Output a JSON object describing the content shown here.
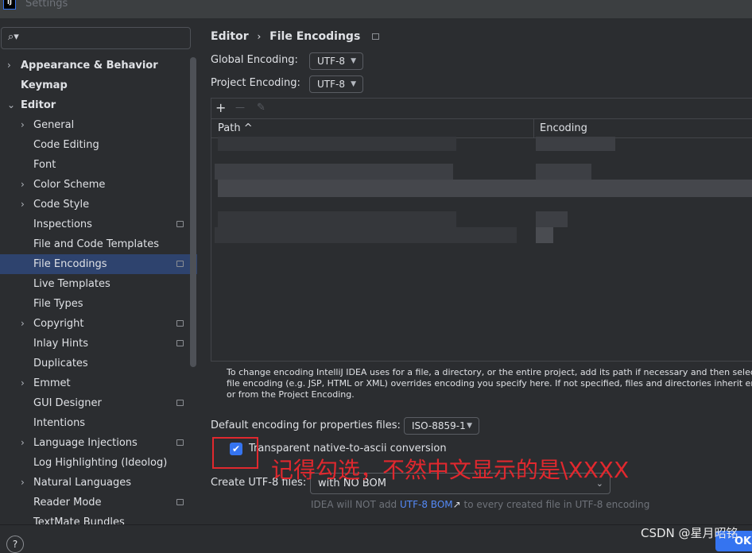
{
  "window": {
    "title": "Settings",
    "logo": "IJ"
  },
  "search": {
    "icon": "search-icon",
    "placeholder": ""
  },
  "sidebar": {
    "items": [
      {
        "label": "Appearance & Behavior",
        "chevron": "›",
        "level": 0
      },
      {
        "label": "Keymap",
        "chevron": "",
        "level": 0
      },
      {
        "label": "Editor",
        "chevron": "⌄",
        "level": 0
      },
      {
        "label": "General",
        "chevron": "›",
        "level": 1
      },
      {
        "label": "Code Editing",
        "chevron": "",
        "level": 1
      },
      {
        "label": "Font",
        "chevron": "",
        "level": 1
      },
      {
        "label": "Color Scheme",
        "chevron": "›",
        "level": 1
      },
      {
        "label": "Code Style",
        "chevron": "›",
        "level": 1
      },
      {
        "label": "Inspections",
        "chevron": "",
        "level": 1,
        "badge": true
      },
      {
        "label": "File and Code Templates",
        "chevron": "",
        "level": 1
      },
      {
        "label": "File Encodings",
        "chevron": "",
        "level": 1,
        "badge": true,
        "selected": true
      },
      {
        "label": "Live Templates",
        "chevron": "",
        "level": 1
      },
      {
        "label": "File Types",
        "chevron": "",
        "level": 1
      },
      {
        "label": "Copyright",
        "chevron": "›",
        "level": 1,
        "badge": true
      },
      {
        "label": "Inlay Hints",
        "chevron": "",
        "level": 1,
        "badge": true
      },
      {
        "label": "Duplicates",
        "chevron": "",
        "level": 1
      },
      {
        "label": "Emmet",
        "chevron": "›",
        "level": 1
      },
      {
        "label": "GUI Designer",
        "chevron": "",
        "level": 1,
        "badge": true
      },
      {
        "label": "Intentions",
        "chevron": "",
        "level": 1
      },
      {
        "label": "Language Injections",
        "chevron": "›",
        "level": 1,
        "badge": true
      },
      {
        "label": "Log Highlighting (Ideolog)",
        "chevron": "",
        "level": 1
      },
      {
        "label": "Natural Languages",
        "chevron": "›",
        "level": 1
      },
      {
        "label": "Reader Mode",
        "chevron": "",
        "level": 1,
        "badge": true
      },
      {
        "label": "TextMate Bundles",
        "chevron": "",
        "level": 1
      }
    ]
  },
  "breadcrumb": {
    "parent": "Editor",
    "sep": "›",
    "current": "File Encodings"
  },
  "global_encoding": {
    "label": "Global Encoding:",
    "value": "UTF-8"
  },
  "project_encoding": {
    "label": "Project Encoding:",
    "value": "UTF-8"
  },
  "toolbar": {
    "add": "+",
    "remove": "—",
    "edit": "✎"
  },
  "table": {
    "columns": [
      "Path ^",
      "Encoding"
    ]
  },
  "hint": "To change encoding IntelliJ IDEA uses for a file, a directory, or the entire project, add its path if necessary and then select encoding. Project or directory encoding may be overridden by file encoding (e.g. JSP, HTML or XML) overrides encoding you specify here. If not specified, files and directories inherit encodings from the parent directory or from the Project Encoding.",
  "hint_lines": [
    "To change encoding IntelliJ IDEA uses for a file, a directory, or the entire project, add its path if necessary and then select enco",
    "file encoding (e.g. JSP, HTML or XML) overrides encoding you specify here. If not specified, files and directories inherit encodin",
    "or from the Project Encoding."
  ],
  "properties": {
    "label": "Default encoding for properties files:",
    "value": "ISO-8859-1"
  },
  "native_to_ascii": {
    "label": "Transparent native-to-ascii conversion",
    "checked": true
  },
  "annotation": "记得勾选，不然中文显示的是\\XXXX",
  "create_utf8": {
    "label": "Create UTF-8 files:",
    "value": "with NO BOM"
  },
  "bom_note": {
    "prefix": "IDEA will NOT add",
    "link": "UTF-8 BOM",
    "arrow": "↗",
    "suffix": "to every created file in UTF-8 encoding"
  },
  "footer": {
    "help": "?",
    "ok": "OK"
  },
  "watermark": "CSDN @星月昭铭",
  "colors": {
    "accent": "#3574f0",
    "selected": "#2e436e",
    "annotation": "#e0282e"
  }
}
